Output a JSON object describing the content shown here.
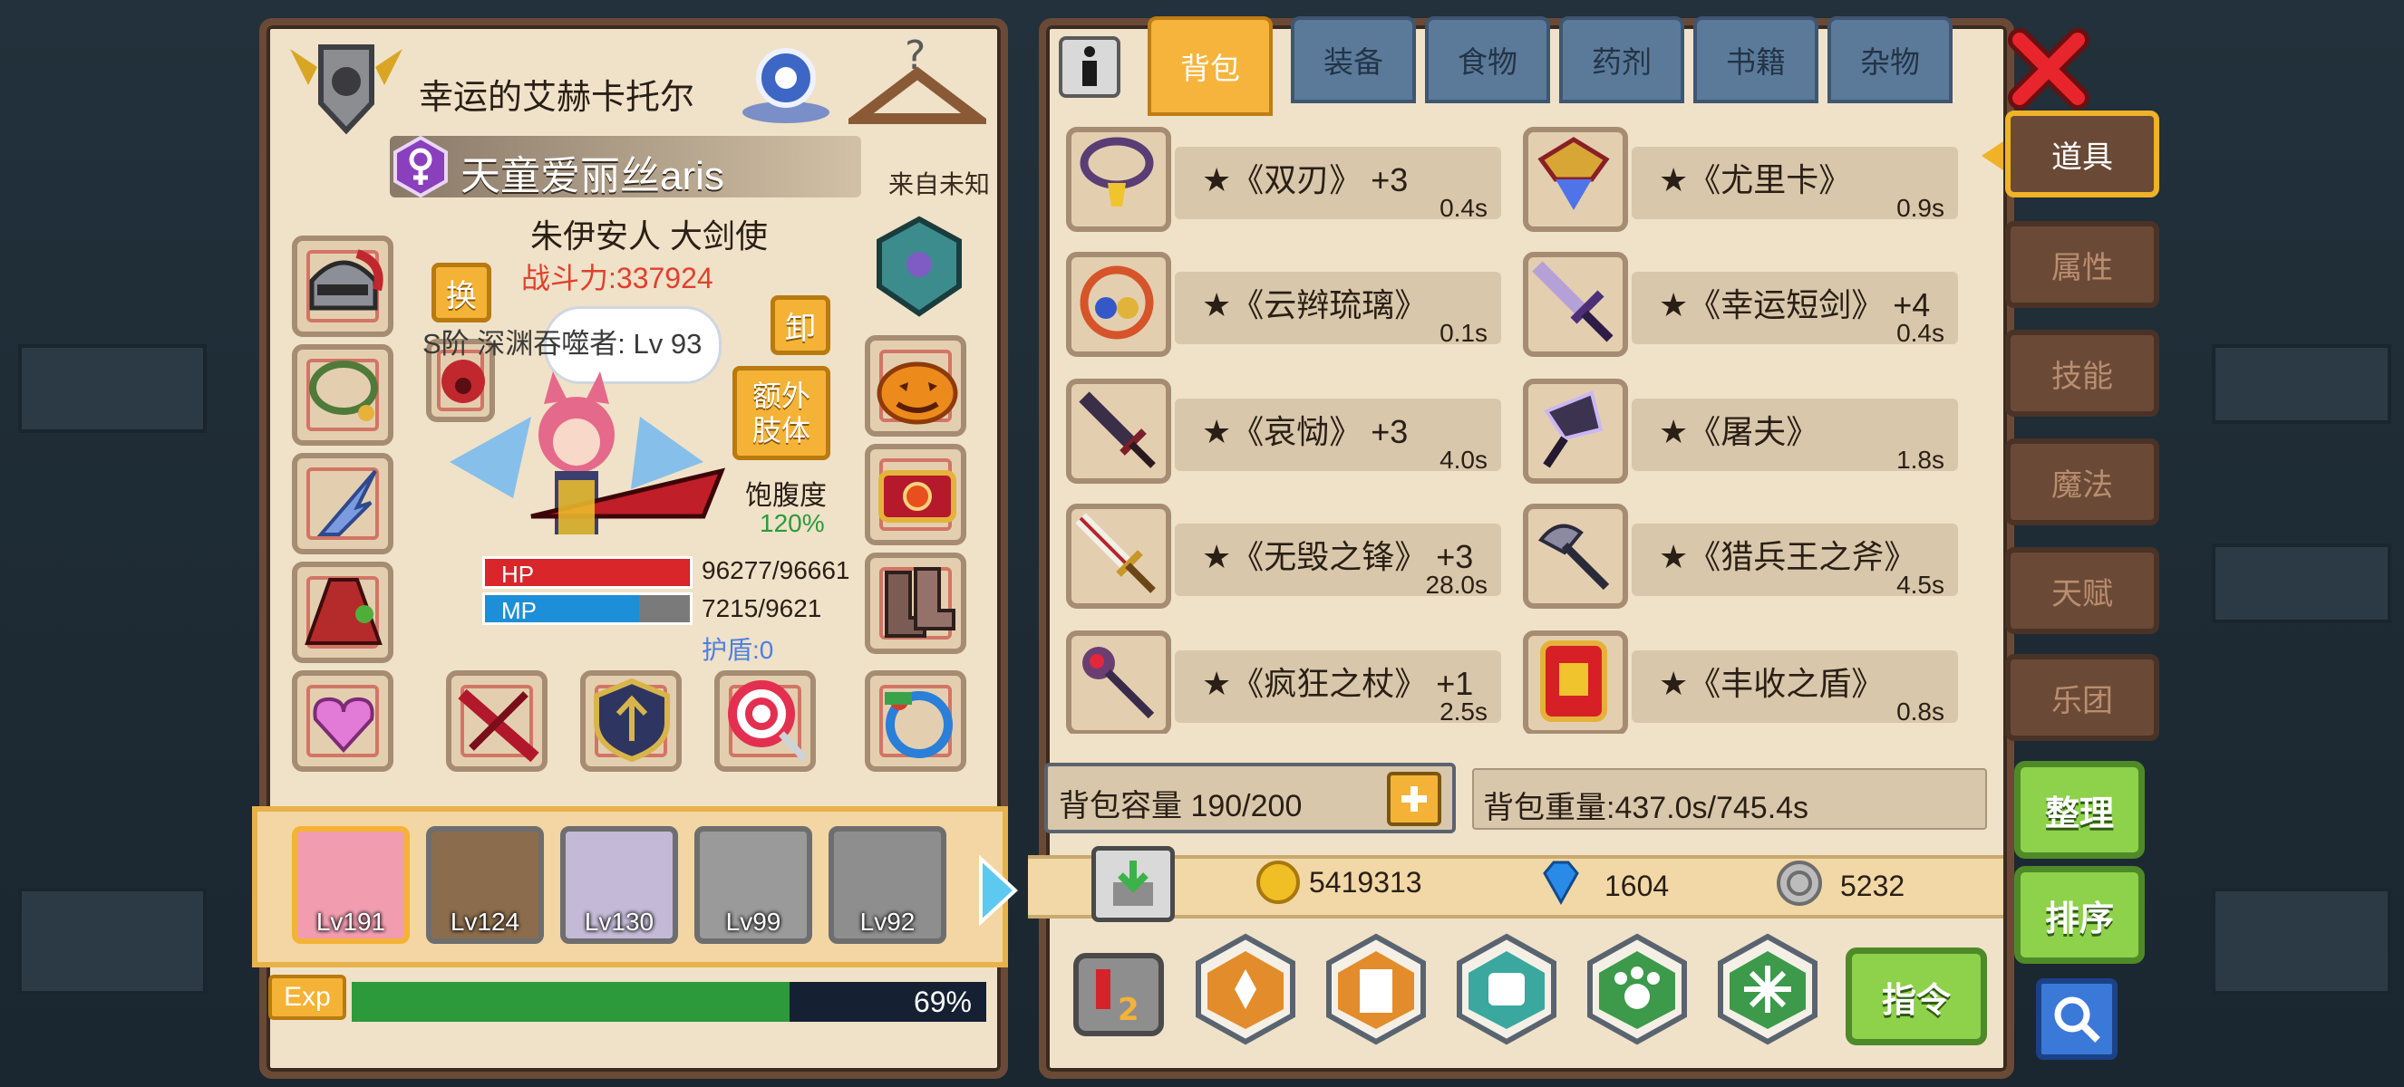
{
  "character": {
    "title": "幸运的艾赫卡托尔",
    "name": "天童爱丽丝aris",
    "origin": "来自未知",
    "race_class": "朱伊安人 大剑使",
    "power": "战斗力:337924",
    "swap_label": "换",
    "unequip_label": "卸",
    "extra_limb_label": "额外\n肢体",
    "rank": "S阶 深渊吞噬者: Lv 93",
    "satiety_label": "饱腹度",
    "satiety_value": "120%",
    "hp_label": "HP",
    "hp_value": "96277/96661",
    "hp_fraction": 0.996,
    "mp_label": "MP",
    "mp_value": "7215/9621",
    "mp_fraction": 0.75,
    "shield": "护盾:0",
    "exp_label": "Exp",
    "exp_percent": "69%",
    "exp_fraction": 0.69
  },
  "party": [
    {
      "lv": "Lv191"
    },
    {
      "lv": "Lv124"
    },
    {
      "lv": "Lv130"
    },
    {
      "lv": "Lv99"
    },
    {
      "lv": "Lv92"
    }
  ],
  "tabs": [
    "背包",
    "装备",
    "食物",
    "药剂",
    "书籍",
    "杂物"
  ],
  "active_tab": "背包",
  "items": [
    {
      "name": "★《双刃》 +3",
      "time": "0.4s"
    },
    {
      "name": "★《尤里卡》",
      "time": "0.9s"
    },
    {
      "name": "★《云辫琉璃》",
      "time": "0.1s"
    },
    {
      "name": "★《幸运短剑》 +4",
      "time": "0.4s"
    },
    {
      "name": "★《哀恸》 +3",
      "time": "4.0s"
    },
    {
      "name": "★《屠夫》",
      "time": "1.8s"
    },
    {
      "name": "★《无毁之锋》 +3",
      "time": "28.0s"
    },
    {
      "name": "★《猎兵王之斧》",
      "time": "4.5s"
    },
    {
      "name": "★《疯狂之杖》 +1",
      "time": "2.5s"
    },
    {
      "name": "★《丰收之盾》",
      "time": "0.8s"
    }
  ],
  "capacity": "背包容量 190/200",
  "weight": "背包重量:437.0s/745.4s",
  "gold": "5419313",
  "gems": "1604",
  "silver": "5232",
  "side_tabs": [
    "道具",
    "属性",
    "技能",
    "魔法",
    "天赋",
    "乐团"
  ],
  "sort_label": "整理",
  "order_label": "排序",
  "command_label": "指令",
  "colors": {
    "accent": "#f6b43c",
    "hp": "#d9262b",
    "mp": "#1d8fd8",
    "exp": "#2c9a3a",
    "power": "#e0402e"
  }
}
